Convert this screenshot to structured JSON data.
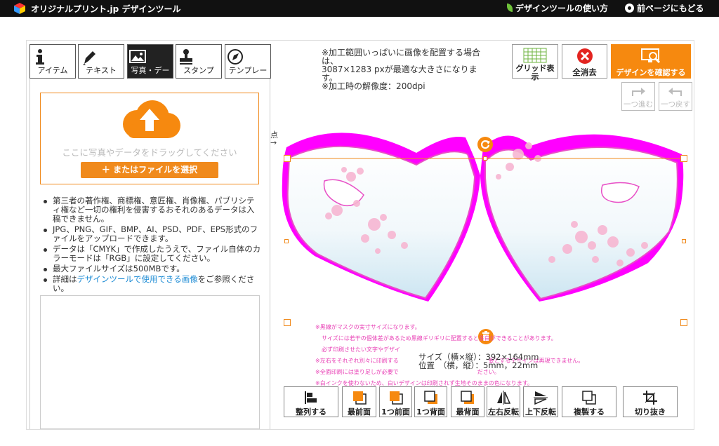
{
  "header": {
    "brand": "オリジナルプリント.jp デザインツール",
    "howto": "デザインツールの使い方",
    "back": "前ページにもどる"
  },
  "tabs": [
    {
      "label": "アイテム",
      "icon": "info-icon"
    },
    {
      "label": "テキスト",
      "icon": "pen-icon"
    },
    {
      "label": "写真・デー",
      "icon": "image-icon",
      "active": true
    },
    {
      "label": "スタンプ",
      "icon": "stamp-icon"
    },
    {
      "label": "テンプレー",
      "icon": "template-icon"
    }
  ],
  "upload": {
    "drop_text": "ここに写真やデータをドラッグしてください",
    "file_button": "＋ またはファイルを選択"
  },
  "notes": [
    "第三者の著作権、商標権、意匠権、肖像権、パブリシティ権など一切の権利を侵害するおそれのあるデータは入稿できません。",
    "JPG、PNG、GIF、BMP、AI、PSD、PDF、EPS形式のファイルをアップロードできます。",
    "データは「CMYK」で作成したうえで、ファイル自体のカラーモードは「RGB」に設定してください。",
    "最大ファイルサイズは500MBです。"
  ],
  "notes_last": {
    "prefix": "詳細は",
    "link": "デザインツールで使用できる画像",
    "suffix": "をご参照ください。"
  },
  "canvas_info": {
    "line1": "※加工範囲いっぱいに画像を配置する場合は、",
    "line2": "3087×1283 pxが最適な大きさになります。",
    "line3": "※加工時の解像度：200dpi"
  },
  "toolbar_top": {
    "grid": "グリッド表示",
    "clear": "全消去",
    "confirm": "デザインを確認する",
    "redo": "一つ進む",
    "undo": "一つ戻す"
  },
  "canvas": {
    "corner_label": "点",
    "hints": [
      "※黒線がマスクの実寸サイズになります。",
      "サイズには若干の個体差があるため黒線ギリギリに配置すると余白ができることがあります。",
      "必ず印刷させたい文字やデザイ",
      "※左右をそれぞれ別々に印刷する　　　　　　　　　　　　　　　　要とするデザインは再現できません。",
      "※全面印刷には塗り足しが必要で　　　　　　　　　　　　　　ださい。",
      "※白インクを使わないため、白いデザインは印刷されず生地そのままの色になります。"
    ],
    "size_label": "サイズ（横×縦）：392×164mm",
    "pos_label": "位置　（横，縦）：5mm，22mm"
  },
  "toolbar_bottom": [
    {
      "label": "整列する",
      "icon": "align-icon"
    },
    {
      "label": "最前面",
      "icon": "bring-front-icon"
    },
    {
      "label": "1つ前面",
      "icon": "bring-forward-icon"
    },
    {
      "label": "1つ背面",
      "icon": "send-backward-icon"
    },
    {
      "label": "最背面",
      "icon": "send-back-icon"
    },
    {
      "label": "左右反転",
      "icon": "flip-horizontal-icon"
    },
    {
      "label": "上下反転",
      "icon": "flip-vertical-icon"
    },
    {
      "label": "複製する",
      "icon": "duplicate-icon"
    },
    {
      "label": "切り抜き",
      "icon": "crop-icon"
    }
  ],
  "colors": {
    "accent": "#f6890f",
    "mask_outline": "#ff00ff",
    "hint_text": "#e83fb5",
    "link": "#1a8ad4"
  }
}
